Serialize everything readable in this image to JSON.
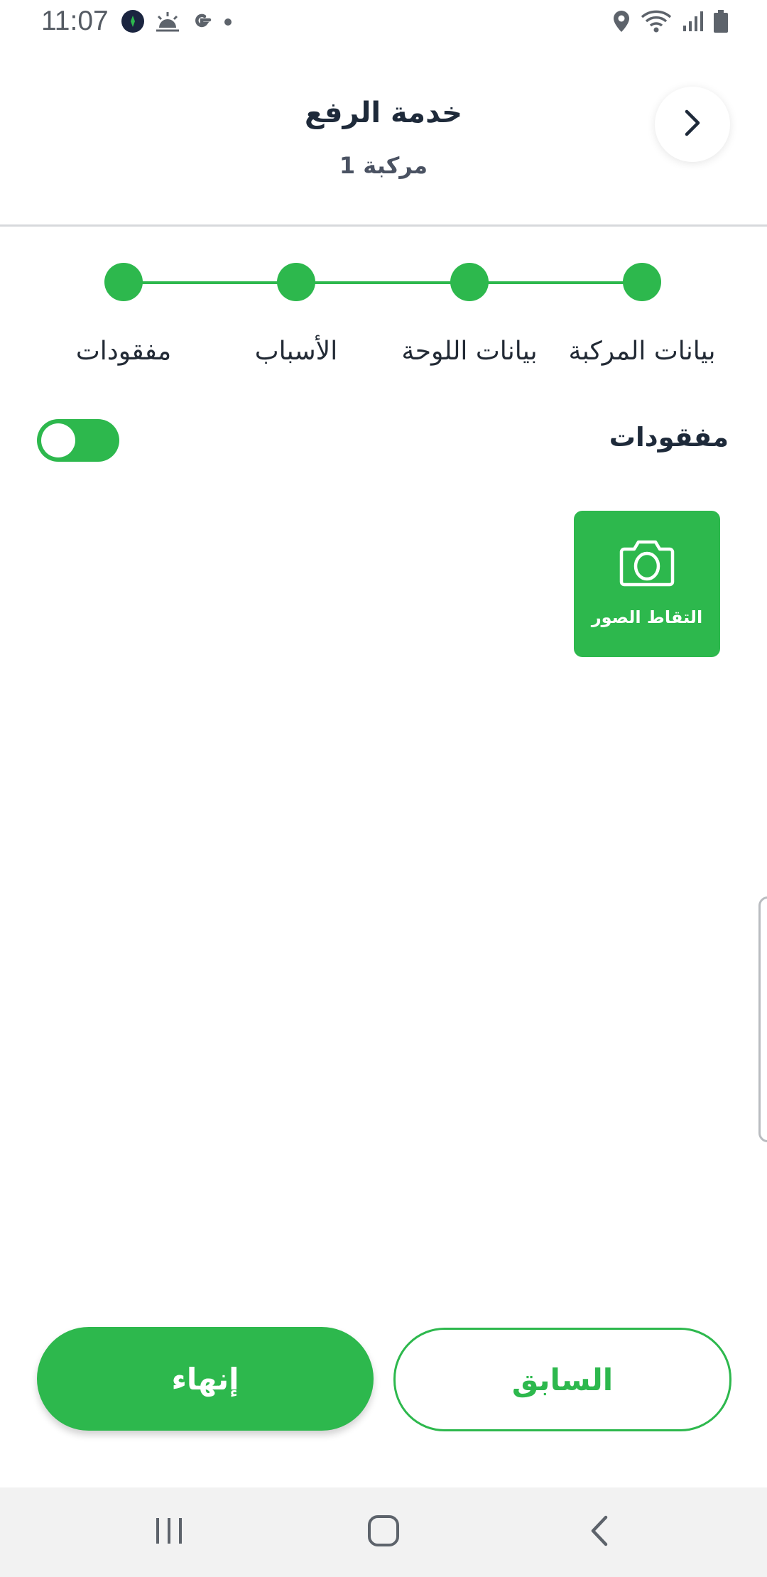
{
  "status_bar": {
    "time": "11:07",
    "left_icons": [
      "app-badge-icon",
      "weather-icon",
      "google-icon",
      "notification-dot-icon"
    ],
    "right_icons": [
      "location-icon",
      "wifi-icon",
      "signal-icon",
      "battery-icon"
    ]
  },
  "header": {
    "title": "خدمة الرفع",
    "subtitle": "مركبة 1",
    "back_icon": "chevron-right-icon"
  },
  "stepper": {
    "steps": [
      {
        "label": "بيانات المركبة"
      },
      {
        "label": "بيانات اللوحة"
      },
      {
        "label": "الأسباب"
      },
      {
        "label": "مفقودات"
      }
    ]
  },
  "lost_items": {
    "label": "مفقودات",
    "toggle_on": true,
    "capture_button_label": "التقاط الصور",
    "capture_icon": "camera-icon"
  },
  "actions": {
    "finish_label": "إنهاء",
    "previous_label": "السابق"
  },
  "nav_bar": {
    "icons": [
      "recent-apps-icon",
      "home-icon",
      "back-icon"
    ]
  },
  "colors": {
    "accent": "#2db84d",
    "title_text": "#1e2a3a",
    "divider": "#d7d9dc",
    "nav_bar_bg": "#f2f2f2"
  }
}
